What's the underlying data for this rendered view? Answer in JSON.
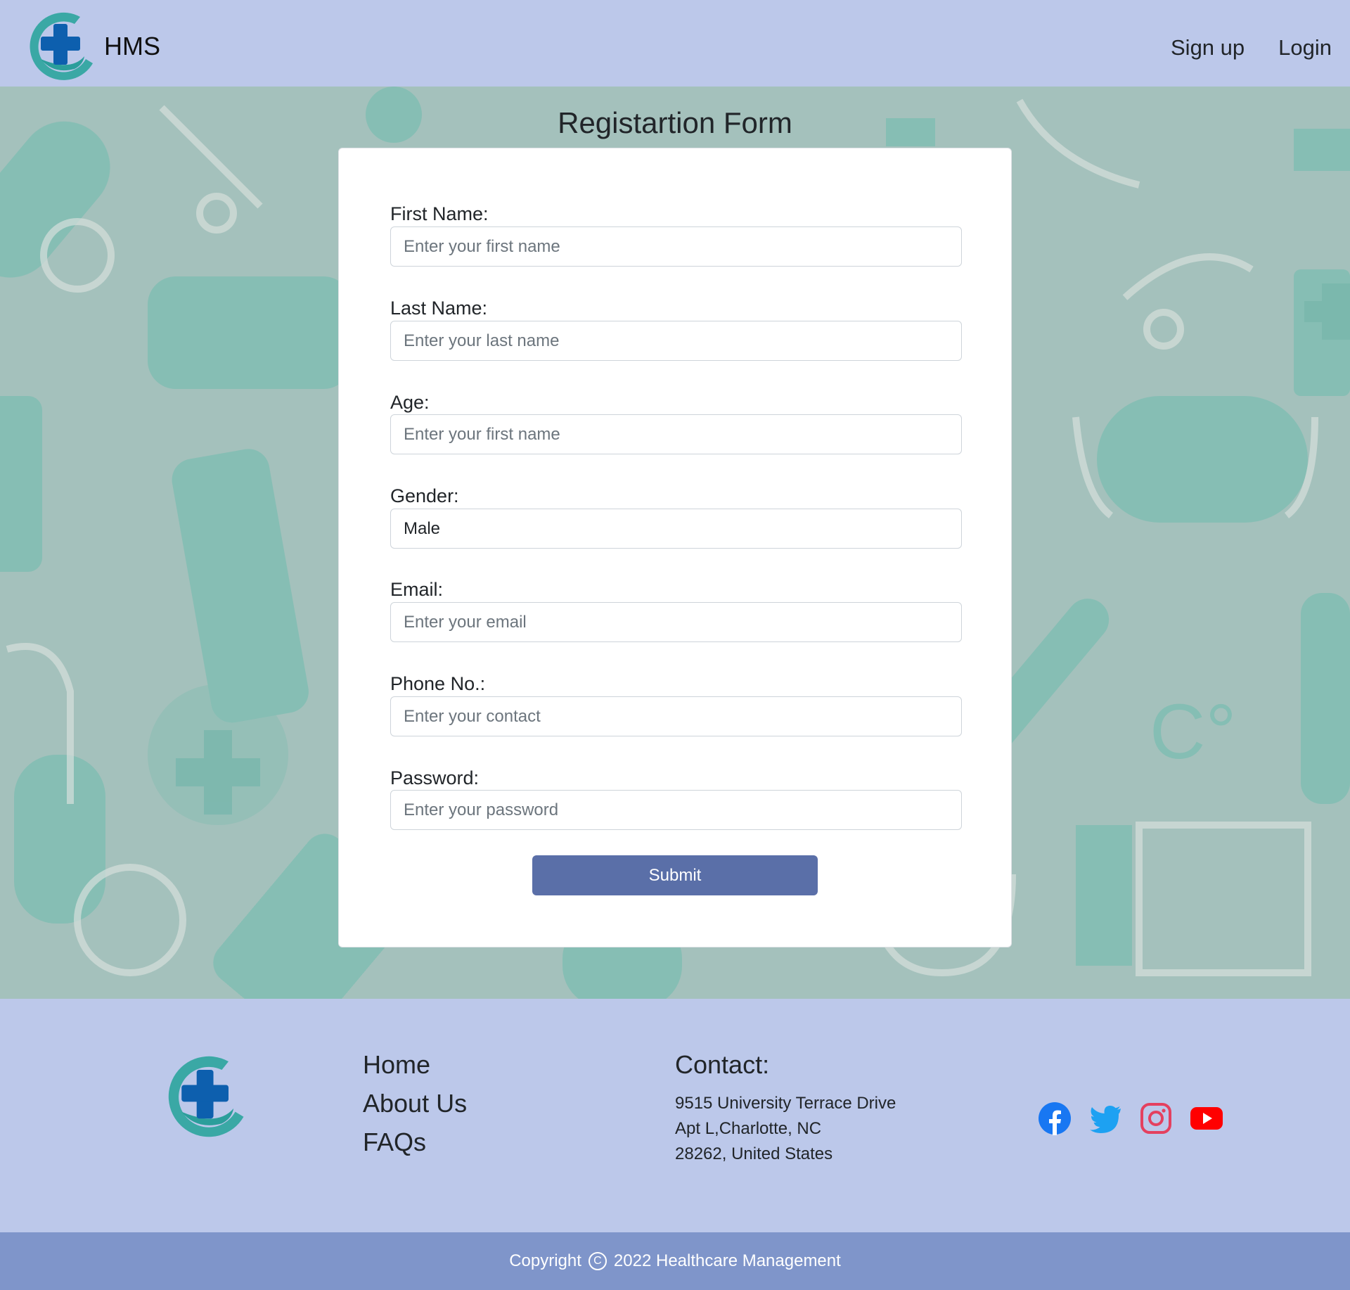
{
  "header": {
    "brand": "HMS",
    "nav": {
      "signup": "Sign up",
      "login": "Login"
    }
  },
  "form": {
    "title": "Registartion Form",
    "fields": {
      "first_name": {
        "label": "First Name:",
        "placeholder": "Enter your first name"
      },
      "last_name": {
        "label": "Last Name:",
        "placeholder": "Enter your last name"
      },
      "age": {
        "label": "Age:",
        "placeholder": "Enter your first name"
      },
      "gender": {
        "label": "Gender:",
        "value": "Male"
      },
      "email": {
        "label": "Email:",
        "placeholder": "Enter your email"
      },
      "phone": {
        "label": "Phone No.:",
        "placeholder": "Enter your contact"
      },
      "password": {
        "label": "Password:",
        "placeholder": "Enter your password"
      }
    },
    "submit_label": "Submit"
  },
  "footer": {
    "links": {
      "home": "Home",
      "about": "About Us",
      "faqs": "FAQs"
    },
    "contact": {
      "title": "Contact:",
      "line1": "9515 University Terrace Drive",
      "line2": "Apt L,Charlotte, NC",
      "line3": "28262, United States"
    },
    "socials": [
      "facebook-icon",
      "twitter-icon",
      "instagram-icon",
      "youtube-icon"
    ],
    "copyright_prefix": "Copyright",
    "copyright_text": "2022 Healthcare Management"
  },
  "colors": {
    "header_bg": "#bcc8ea",
    "hero_bg": "#a4c1bc",
    "accent_teal": "#6db6ac",
    "button": "#5a6fa8",
    "copyright_bg": "#7f95ca",
    "facebook": "#1877f2",
    "twitter": "#1da1f2",
    "instagram": "#e4405f",
    "youtube": "#ff0000"
  }
}
